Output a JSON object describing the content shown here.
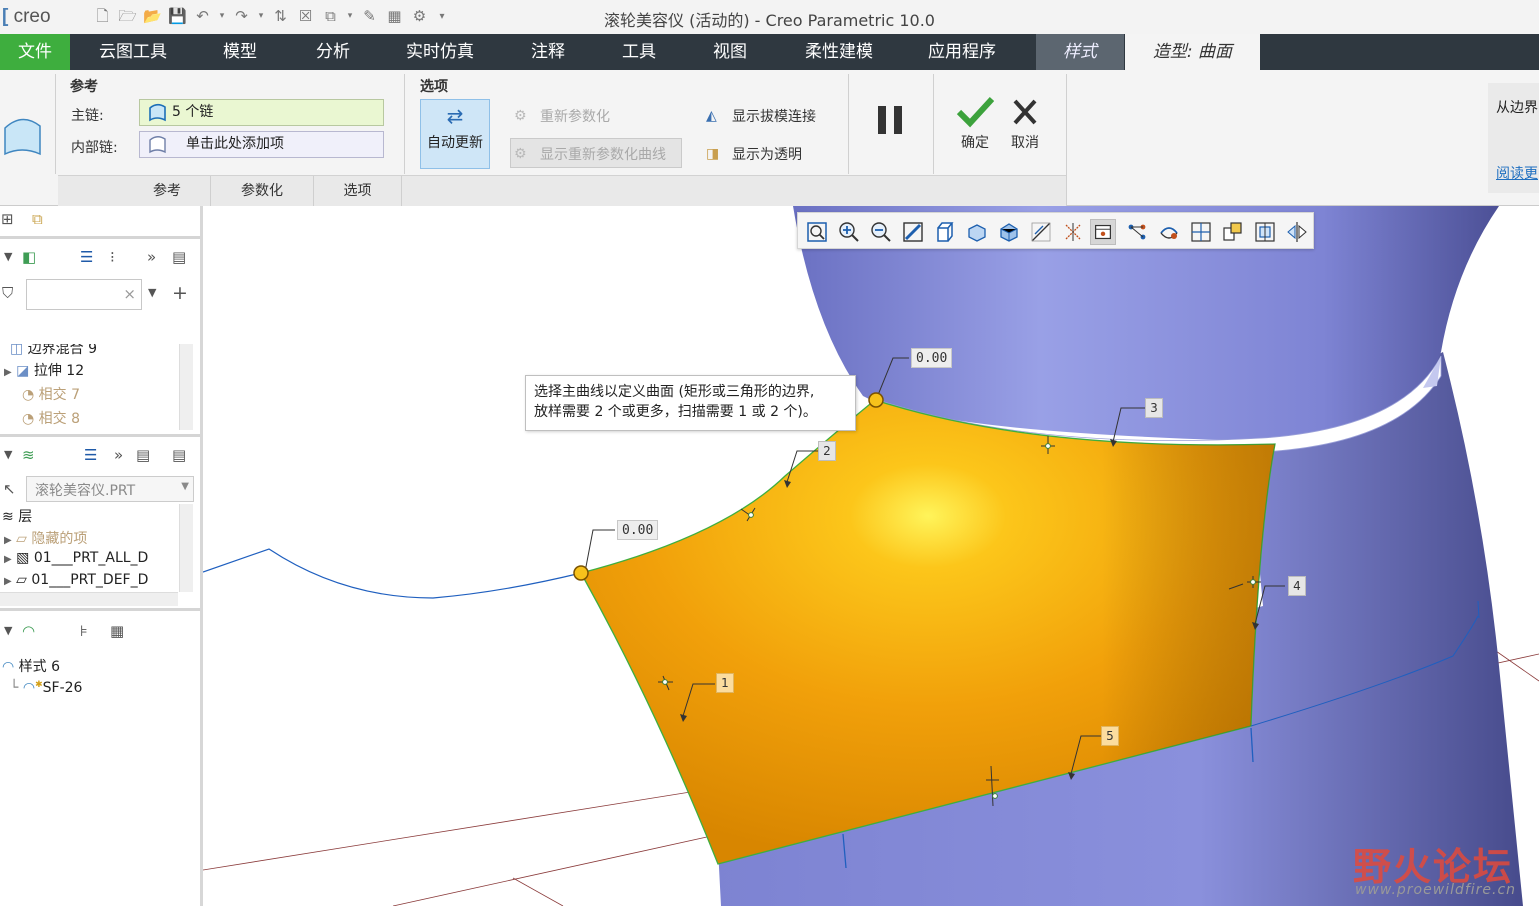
{
  "titlebar": {
    "logo": "creo",
    "window_title": "滚轮美容仪 (活动的) - Creo Parametric 10.0"
  },
  "menu": {
    "file": "文件",
    "tabs": [
      "云图工具",
      "模型",
      "分析",
      "实时仿真",
      "注释",
      "工具",
      "视图",
      "柔性建模",
      "应用程序"
    ],
    "style_tab": "样式",
    "active_tab": "造型: 曲面"
  },
  "ribbon": {
    "reference_group": "参考",
    "main_chain_label": "主链:",
    "main_chain_value": "5 个链",
    "internal_chain_label": "内部链:",
    "internal_chain_value": "单击此处添加项",
    "options_group": "选项",
    "auto_update": "自动更新",
    "reparam": "重新参数化",
    "show_reparam_curves": "显示重新参数化曲线",
    "show_draft": "显示拔模连接",
    "show_transparent": "显示为透明",
    "ok": "确定",
    "cancel": "取消",
    "subtabs": [
      "参考",
      "参数化",
      "选项"
    ],
    "right_text_1": "从边界",
    "right_text_2": "阅读更"
  },
  "left_panel": {
    "tree_items": [
      {
        "label": "边界混合 9",
        "gray": false
      },
      {
        "label": "拉伸 12",
        "gray": false
      },
      {
        "label": "相交 7",
        "gray": true
      },
      {
        "label": "相交 8",
        "gray": true
      }
    ],
    "model_select": "滚轮美容仪.PRT",
    "layer_root": "层",
    "layer_items": [
      {
        "label": "隐藏的项",
        "gray": true
      },
      {
        "label": "01___PRT_ALL_D",
        "gray": false
      },
      {
        "label": "01___PRT_DEF_D",
        "gray": false
      }
    ],
    "style_root": "样式 6",
    "style_child": "SF-26"
  },
  "viewport": {
    "tooltip_line1": "选择主曲线以定义曲面 (矩形或三角形的边界,",
    "tooltip_line2": "放样需要 2 个或更多，扫描需要 1 或 2 个)。",
    "dim_top": "0.00",
    "dim_left": "0.00",
    "chain_labels": [
      "1",
      "2",
      "3",
      "4",
      "5"
    ],
    "colors": {
      "surface": "#f4a30c",
      "cylinder": "#8a8fd6",
      "curve": "#1f5fbf",
      "edge": "#3fae3f"
    }
  },
  "watermark": {
    "cn": "野火论坛",
    "url": "www.proewildfire.cn"
  }
}
